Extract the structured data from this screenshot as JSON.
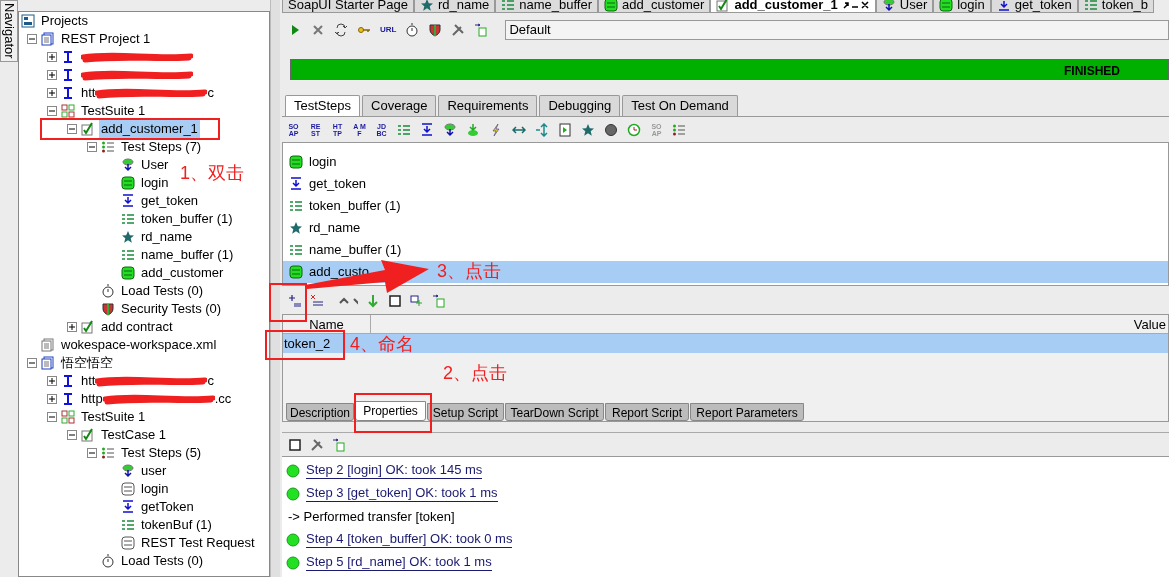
{
  "navigator": {
    "tab": "Navigator"
  },
  "tree": [
    {
      "kind": "projects",
      "label": "Projects",
      "selected": false,
      "children": [
        {
          "kind": "project",
          "label": "REST Project 1",
          "expanded": true,
          "selected": false,
          "children": [
            {
              "kind": "interface",
              "redacted": true,
              "expanded": false,
              "selected": false
            },
            {
              "kind": "interface",
              "redacted": true,
              "expanded": false,
              "selected": false
            },
            {
              "kind": "interface",
              "redacted": true,
              "label": "htt",
              "label_end": "c",
              "expanded": false,
              "selected": false
            },
            {
              "kind": "suite",
              "label": "TestSuite 1",
              "expanded": true,
              "selected": false,
              "children": [
                {
                  "kind": "case",
                  "label": "add_customer_1",
                  "expanded": true,
                  "selected": true,
                  "children": [
                    {
                      "kind": "steps",
                      "label": "Test Steps (7)",
                      "expanded": true,
                      "selected": false,
                      "children": [
                        {
                          "kind": "datasource",
                          "label": "User",
                          "selected": false
                        },
                        {
                          "kind": "rest",
                          "label": "login",
                          "selected": false
                        },
                        {
                          "kind": "transfer",
                          "label": "get_token",
                          "selected": false
                        },
                        {
                          "kind": "buffer",
                          "label": "token_buffer (1)",
                          "selected": false
                        },
                        {
                          "kind": "star",
                          "label": "rd_name",
                          "selected": false
                        },
                        {
                          "kind": "buffer",
                          "label": "name_buffer (1)",
                          "selected": false
                        },
                        {
                          "kind": "rest",
                          "label": "add_customer",
                          "selected": false
                        }
                      ]
                    },
                    {
                      "kind": "load",
                      "label": "Load Tests (0)",
                      "selected": false
                    },
                    {
                      "kind": "security",
                      "label": "Security Tests (0)",
                      "selected": false
                    }
                  ]
                },
                {
                  "kind": "case",
                  "label": "add contract",
                  "expanded": false,
                  "selected": false
                }
              ]
            }
          ]
        },
        {
          "kind": "workspace",
          "label": "wokespace-workspace.xml",
          "selected": false
        },
        {
          "kind": "project",
          "label": "悟空悟空",
          "expanded": true,
          "selected": false,
          "children": [
            {
              "kind": "interface",
              "redacted": true,
              "label": "htt",
              "label_end": "c",
              "expanded": false,
              "selected": false
            },
            {
              "kind": "interface",
              "redacted": true,
              "label": "http",
              "label_end": ".cc",
              "expanded": false,
              "selected": false
            },
            {
              "kind": "suite",
              "label": "TestSuite 1",
              "expanded": true,
              "selected": false,
              "children": [
                {
                  "kind": "case",
                  "label": "TestCase 1",
                  "expanded": true,
                  "selected": false,
                  "children": [
                    {
                      "kind": "steps",
                      "label": "Test Steps (5)",
                      "expanded": true,
                      "selected": false,
                      "children": [
                        {
                          "kind": "datasource",
                          "label": "user",
                          "selected": false
                        },
                        {
                          "kind": "rest-plain",
                          "label": "login",
                          "selected": false
                        },
                        {
                          "kind": "transfer",
                          "label": "getToken",
                          "selected": false
                        },
                        {
                          "kind": "buffer",
                          "label": "tokenBuf (1)",
                          "selected": false
                        },
                        {
                          "kind": "rest-plain",
                          "label": "REST Test Request",
                          "selected": false
                        }
                      ]
                    },
                    {
                      "kind": "load",
                      "label": "Load Tests (0)",
                      "selected": false
                    }
                  ]
                }
              ]
            }
          ]
        }
      ]
    }
  ],
  "editor_tabs": [
    {
      "kind": "plain",
      "label": "SoapUI Starter Page",
      "selected": false
    },
    {
      "kind": "star",
      "label": "rd_name",
      "selected": false
    },
    {
      "kind": "buffer",
      "label": "name_buffer",
      "selected": false
    },
    {
      "kind": "rest",
      "label": "add_customer",
      "selected": false
    },
    {
      "kind": "case",
      "label": "add_customer_1",
      "selected": true
    },
    {
      "kind": "datasource",
      "label": "User",
      "selected": false
    },
    {
      "kind": "rest",
      "label": "login",
      "selected": false
    },
    {
      "kind": "transfer",
      "label": "get_token",
      "selected": false
    },
    {
      "kind": "buffer",
      "label": "token_b",
      "selected": false
    }
  ],
  "run_toolbar": [
    {
      "kind": "play"
    },
    {
      "kind": "stop"
    },
    {
      "kind": "loop"
    },
    {
      "kind": "key"
    },
    {
      "kind": "text",
      "text": "URL"
    },
    {
      "kind": "stopwatch"
    },
    {
      "kind": "security"
    },
    {
      "kind": "wrench"
    },
    {
      "kind": "export"
    }
  ],
  "environment": {
    "value": "Default"
  },
  "progress": {
    "status": "FINISHED",
    "level": 1
  },
  "inner_tabs": [
    {
      "label": "TestSteps",
      "selected": true
    },
    {
      "label": "Coverage",
      "selected": false
    },
    {
      "label": "Requirements",
      "selected": false
    },
    {
      "label": "Debugging",
      "selected": false
    },
    {
      "label": "Test On Demand",
      "selected": false
    }
  ],
  "steps_toolbar": [
    {
      "kind": "text",
      "text": "SO AP"
    },
    {
      "kind": "text",
      "text": "RE ST"
    },
    {
      "kind": "text",
      "text": "HT TP"
    },
    {
      "kind": "text",
      "text": "A MF"
    },
    {
      "kind": "text",
      "text": "JD BC"
    },
    {
      "kind": "buffer"
    },
    {
      "kind": "transfer"
    },
    {
      "kind": "datasource"
    },
    {
      "kind": "dataloop"
    },
    {
      "kind": "lightning"
    },
    {
      "kind": "arrows"
    },
    {
      "kind": "split"
    },
    {
      "kind": "doc"
    },
    {
      "kind": "star"
    },
    {
      "kind": "circle"
    },
    {
      "kind": "clock"
    },
    {
      "kind": "text-gray",
      "text": "SO AP"
    },
    {
      "kind": "steps"
    }
  ],
  "test_steps": [
    {
      "kind": "rest",
      "label": "login",
      "selected": false
    },
    {
      "kind": "transfer",
      "label": "get_token",
      "selected": false
    },
    {
      "kind": "buffer",
      "label": "token_buffer (1)",
      "selected": false
    },
    {
      "kind": "star",
      "label": "rd_name",
      "selected": false
    },
    {
      "kind": "buffer",
      "label": "name_buffer (1)",
      "selected": false
    },
    {
      "kind": "rest",
      "label": "add_custo",
      "selected": true
    }
  ],
  "properties_toolbar": [
    {
      "kind": "add"
    },
    {
      "kind": "remove"
    },
    {
      "kind": "updown"
    },
    {
      "kind": "down"
    },
    {
      "kind": "square"
    },
    {
      "kind": "import"
    },
    {
      "kind": "export"
    }
  ],
  "properties_table": {
    "columns": [
      "Name",
      "Value"
    ],
    "rows": [
      {
        "name": "token_2",
        "selected": true
      }
    ]
  },
  "bottom_tabs": [
    {
      "label": "Description",
      "selected": false
    },
    {
      "label": "Properties",
      "selected": true
    },
    {
      "label": "Setup Script",
      "selected": false
    },
    {
      "label": "TearDown Script",
      "selected": false
    },
    {
      "label": "Report Script",
      "selected": false
    },
    {
      "label": "Report Parameters",
      "selected": false
    }
  ],
  "log_toolbar": [
    {
      "kind": "square"
    },
    {
      "kind": "wrench"
    },
    {
      "kind": "export"
    }
  ],
  "log": [
    {
      "kind": "step",
      "text": "Step 2 [login] OK: took 145 ms"
    },
    {
      "kind": "step",
      "text": "Step 3 [get_token] OK: took 1 ms"
    },
    {
      "kind": "info",
      "text": "-> Performed transfer [token]"
    },
    {
      "kind": "step",
      "text": "Step 4 [token_buffer] OK: took 0 ms"
    },
    {
      "kind": "step",
      "text": "Step 5 [rd_name] OK: took 1 ms"
    }
  ],
  "annotations": [
    {
      "kind": "box"
    },
    {
      "kind": "label",
      "text": "1、双击"
    },
    {
      "kind": "arrow"
    },
    {
      "kind": "label",
      "text": "3、点击"
    },
    {
      "kind": "box"
    },
    {
      "kind": "box"
    },
    {
      "kind": "label",
      "text": "4、命名"
    },
    {
      "kind": "label",
      "text": "2、点击"
    },
    {
      "kind": "box"
    }
  ]
}
